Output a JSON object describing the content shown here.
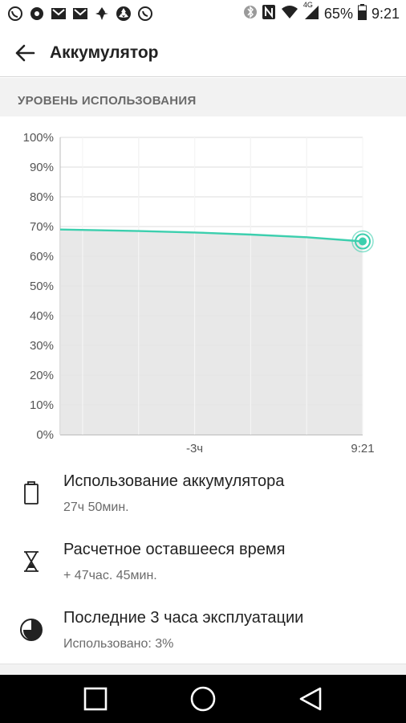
{
  "status_bar": {
    "battery_percent": "65%",
    "time": "9:21",
    "network_type": "4G",
    "left_icons": [
      "viber-icon",
      "notification-icon",
      "gmail-icon",
      "gmail-icon",
      "notification-icon",
      "notification-icon",
      "whatsapp-icon"
    ],
    "right_icons": [
      "bluetooth-icon",
      "nfc-icon",
      "wifi-icon",
      "signal-icon",
      "battery-icon"
    ]
  },
  "app_bar": {
    "title": "Аккумулятор"
  },
  "section": {
    "title": "УРОВЕНЬ ИСПОЛЬЗОВАНИЯ"
  },
  "chart_data": {
    "type": "area",
    "title": "",
    "ylabel": "",
    "xlabel": "",
    "y_ticks": [
      "100%",
      "90%",
      "80%",
      "70%",
      "60%",
      "50%",
      "40%",
      "30%",
      "20%",
      "10%",
      "0%"
    ],
    "x_ticks": [
      "-3ч",
      "9:21"
    ],
    "ylim": [
      0,
      100
    ],
    "xlim": [
      -5.4,
      0
    ],
    "series": [
      {
        "x": [
          -5.4,
          -4.0,
          -3.0,
          -2.0,
          -1.0,
          0.0
        ],
        "values": [
          69,
          68.5,
          68,
          67.3,
          66.4,
          65
        ]
      }
    ],
    "current_point": {
      "x": 0,
      "y": 65
    },
    "line_color": "#3ccfae",
    "fill_color": "#e6e6e6",
    "grid": true
  },
  "items": [
    {
      "icon": "battery-icon",
      "title": "Использование аккумулятора",
      "subtitle": "27ч 50мин."
    },
    {
      "icon": "hourglass-icon",
      "title": "Расчетное оставшееся время",
      "subtitle": "+ 47час. 45мин."
    },
    {
      "icon": "half-circle-icon",
      "title": "Последние 3 часа эксплуатации",
      "subtitle": "Использовано: 3%"
    }
  ],
  "nav": {
    "buttons": [
      "recents-button",
      "home-button",
      "back-button"
    ]
  }
}
